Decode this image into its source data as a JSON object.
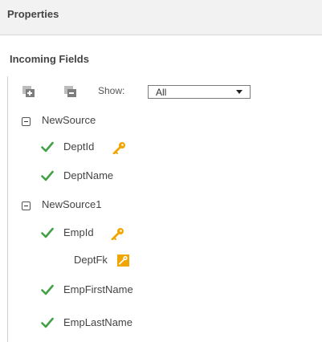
{
  "header": {
    "title": "Properties"
  },
  "section": {
    "title": "Incoming Fields"
  },
  "toolbar": {
    "expand_icon": "expand-all-icon",
    "collapse_icon": "collapse-all-icon",
    "show_label": "Show:",
    "show_value": "All"
  },
  "sources": [
    {
      "name": "NewSource",
      "fields": [
        {
          "name": "DeptId",
          "included": true,
          "key": "primary-key"
        },
        {
          "name": "DeptName",
          "included": true,
          "key": ""
        }
      ]
    },
    {
      "name": "NewSource1",
      "fields": [
        {
          "name": "EmpId",
          "included": true,
          "key": "primary-key"
        },
        {
          "name": "DeptFk",
          "included": false,
          "key": "foreign-key"
        },
        {
          "name": "EmpFirstName",
          "included": true,
          "key": ""
        },
        {
          "name": "EmpLastName",
          "included": true,
          "key": ""
        }
      ]
    }
  ],
  "colors": {
    "check": "#43a047",
    "key": "#f0a500",
    "header_bg": "#f2f2f2"
  }
}
